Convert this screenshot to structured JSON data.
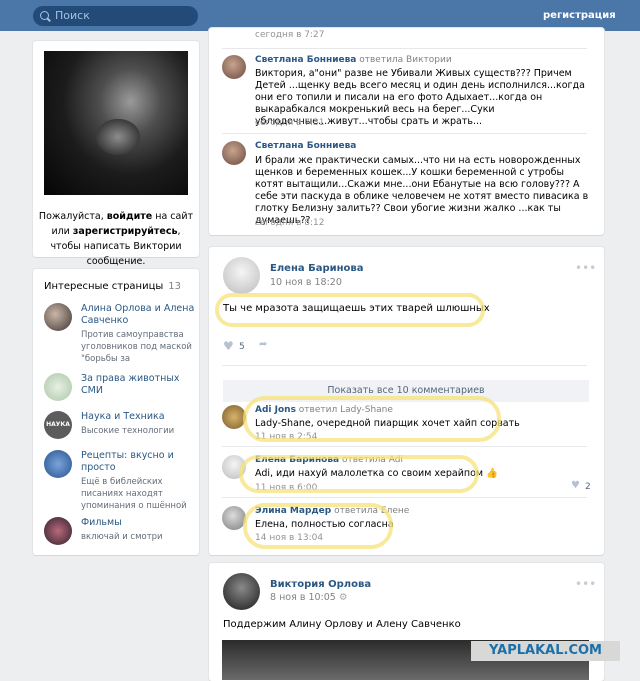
{
  "topbar": {
    "search_placeholder": "Поиск",
    "register_link": "регистрация"
  },
  "profile": {
    "text_1": "Пожалуйста, ",
    "text_login": "войдите",
    "text_2": " на сайт или ",
    "text_register": "зарегистрируйтесь",
    "text_3": ", чтобы написать Виктории сообщение."
  },
  "interesting": {
    "title": "Интересные страницы",
    "count": "13",
    "items": [
      {
        "name": "Алина Орлова и Алена Савченко",
        "desc": "Против самоуправства уголовников под маской \"борьбы за"
      },
      {
        "name": "За права животных СМИ",
        "desc": ""
      },
      {
        "name": "Наука и Техника",
        "desc": "Высокие технологии",
        "avatar_text": "НАУКА"
      },
      {
        "name": "Рецепты: вкусно и просто",
        "desc": "Ещё в библейских писаниях находят упоминания о пшённой"
      },
      {
        "name": "Фильмы",
        "desc": "включай и смотри"
      }
    ]
  },
  "thread": {
    "top_time": "сегодня в 7:27",
    "comments": [
      {
        "author": "Светлана Бонниева",
        "reply": "ответила Виктории",
        "text": "Виктория, а\"они\" разве не Убивали Живых существ??? Причем Детей ...щенку ведь всего месяц и один день исполнился...когда они его топили и писали на его фото Адыхает...когда он выкарабкался мокренький весь на берег...Суки ублюдочные...живут...чтобы срать и жрать...",
        "time": "сегодня в 7:31"
      },
      {
        "author": "Светлана Бонниева",
        "reply": "",
        "text": "И брали же практически самых...что ни на есть новорожденных щенков и беременных кошек...У кошки беременной с утробы котят вытащили...Скажи мне...они Ебанутые на всю голову??? А себе эти паскуда в облике человечем не хотят вместо пивасика в глотку Белизну залить?? Свои убогие жизни жалко ...как ты думаешь??",
        "time": "сегодня в 8:12"
      }
    ]
  },
  "post1": {
    "author": "Елена Баринова",
    "date": "10 ноя в 18:20",
    "text": "Ты че мразота защищаешь этих тварей шлюшных",
    "likes": "5",
    "show_all": "Показать все 10 комментариев",
    "comments": [
      {
        "author": "Adi Jons",
        "reply": "ответил Lady-Shane",
        "text": "Lady-Shane, очередной пиарщик хочет хайп сорвать",
        "time": "11 ноя в 2:54",
        "likes": ""
      },
      {
        "author": "Елена Баринова",
        "reply": "ответила Adi",
        "text": "Adi, иди нахуй малолетка со своим херайпом",
        "emoji": "👍",
        "time": "11 ноя в 6:00",
        "likes": "2"
      },
      {
        "author": "Элина Мардер",
        "reply": "ответила Елене",
        "text": "Елена, полностью согласна",
        "time": "14 ноя в 13:04",
        "likes": ""
      }
    ]
  },
  "post2": {
    "author": "Виктория Орлова",
    "date": "8 ноя в 10:05",
    "text": "Поддержим Алину Орлову и Алену Савченко"
  },
  "watermark": "YAPLAKAL.COM"
}
